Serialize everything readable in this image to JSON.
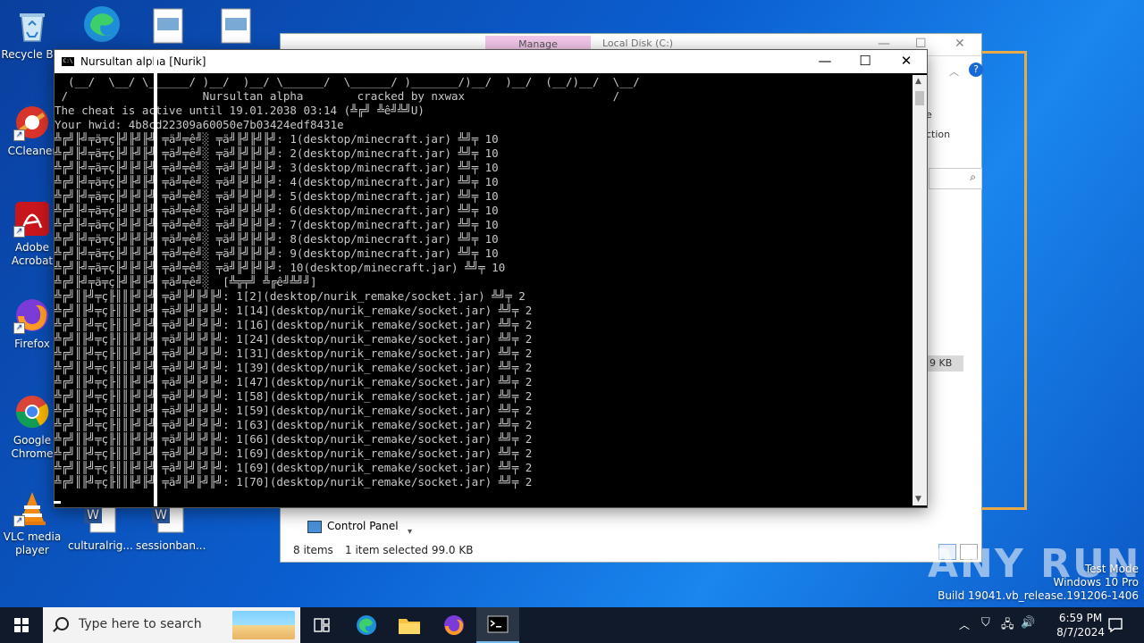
{
  "desktop": {
    "icons": [
      {
        "label": "Recycle Bin",
        "icon": "recycle-bin-icon"
      },
      {
        "label": "CCleaner",
        "icon": "ccleaner-icon"
      },
      {
        "label": "Adobe Acrobat",
        "icon": "adobe-acrobat-icon"
      },
      {
        "label": "Firefox",
        "icon": "firefox-icon"
      },
      {
        "label": "Google Chrome",
        "icon": "chrome-icon"
      },
      {
        "label": "VLC media player",
        "icon": "vlc-icon"
      },
      {
        "label": "culturalrig...",
        "icon": "word-doc-icon"
      },
      {
        "label": "sessionban...",
        "icon": "word-doc-icon"
      }
    ]
  },
  "explorer": {
    "manage_tab": "Manage",
    "title": "Local Disk (C:)",
    "side_fragments": [
      "e",
      "ction"
    ],
    "control_panel": "Control Panel",
    "size_badge": "9 KB",
    "status_items": "8 items",
    "status_selected": "1 item selected  99.0 KB"
  },
  "console": {
    "title": "Nursultan alpha [Nurik]",
    "lines": [
      "  (__/  \\__/ \\______/ )__/  )__/ \\______/  \\______/ )_______/)__/  )__/  (__/)__/  \\__/",
      " /                    Nursultan alpha        cracked by nxwax                      /",
      "The cheat is active until 19.01.2038 03:14 (╩╔╝ ╩ê╝╩╝U)",
      "Your hwid: 4b8cd22309a60050e7b03424edf8431e",
      "╩╔╝╟╝╤ä╤ç╟╝╟╝╟╝ ╤ä╝╤ê╝░ ╤ä╝╟╝╟╝╟╝: 1(desktop/minecraft.jar) ╩╝╤ 10",
      "╩╔╝╟╝╤ä╤ç╟╝╟╝╟╝ ╤ä╝╤ê╝░ ╤ä╝╟╝╟╝╟╝: 2(desktop/minecraft.jar) ╩╝╤ 10",
      "╩╔╝╟╝╤ä╤ç╟╝╟╝╟╝ ╤ä╝╤ê╝░ ╤ä╝╟╝╟╝╟╝: 3(desktop/minecraft.jar) ╩╝╤ 10",
      "╩╔╝╟╝╤ä╤ç╟╝╟╝╟╝ ╤ä╝╤ê╝░ ╤ä╝╟╝╟╝╟╝: 4(desktop/minecraft.jar) ╩╝╤ 10",
      "╩╔╝╟╝╤ä╤ç╟╝╟╝╟╝ ╤ä╝╤ê╝░ ╤ä╝╟╝╟╝╟╝: 5(desktop/minecraft.jar) ╩╝╤ 10",
      "╩╔╝╟╝╤ä╤ç╟╝╟╝╟╝ ╤ä╝╤ê╝░ ╤ä╝╟╝╟╝╟╝: 6(desktop/minecraft.jar) ╩╝╤ 10",
      "╩╔╝╟╝╤ä╤ç╟╝╟╝╟╝ ╤ä╝╤ê╝░ ╤ä╝╟╝╟╝╟╝: 7(desktop/minecraft.jar) ╩╝╤ 10",
      "╩╔╝╟╝╤ä╤ç╟╝╟╝╟╝ ╤ä╝╤ê╝░ ╤ä╝╟╝╟╝╟╝: 8(desktop/minecraft.jar) ╩╝╤ 10",
      "╩╔╝╟╝╤ä╤ç╟╝╟╝╟╝ ╤ä╝╤ê╝░ ╤ä╝╟╝╟╝╟╝: 9(desktop/minecraft.jar) ╩╝╤ 10",
      "╩╔╝╟╝╤ä╤ç╟╝╟╝╟╝ ╤ä╝╤ê╝░ ╤ä╝╟╝╟╝╟╝: 10(desktop/minecraft.jar) ╩╝╤ 10",
      "╩╔╝╟╝╤ä╤ç╟╝╟╝╟╝ ╤ä╝╤ê╝░  [╩╦╤╝ ╩╔ê╝╩╝╝]",
      "╩╔╝║╟╝╤ç╟║║╟╝╟╝ ╤ä╝╟╝╟╝╟╝: 1[2](desktop/nurik_remake/socket.jar) ╩╝╤ 2",
      "╩╔╝║╟╝╤ç╟║║╟╝╟╝ ╤ä╝╟╝╟╝╟╝: 1[14](desktop/nurik_remake/socket.jar) ╩╝╤ 2",
      "╩╔╝║╟╝╤ç╟║║╟╝╟╝ ╤ä╝╟╝╟╝╟╝: 1[16](desktop/nurik_remake/socket.jar) ╩╝╤ 2",
      "╩╔╝║╟╝╤ç╟║║╟╝╟╝ ╤ä╝╟╝╟╝╟╝: 1[24](desktop/nurik_remake/socket.jar) ╩╝╤ 2",
      "╩╔╝║╟╝╤ç╟║║╟╝╟╝ ╤ä╝╟╝╟╝╟╝: 1[31](desktop/nurik_remake/socket.jar) ╩╝╤ 2",
      "╩╔╝║╟╝╤ç╟║║╟╝╟╝ ╤ä╝╟╝╟╝╟╝: 1[39](desktop/nurik_remake/socket.jar) ╩╝╤ 2",
      "╩╔╝║╟╝╤ç╟║║╟╝╟╝ ╤ä╝╟╝╟╝╟╝: 1[47](desktop/nurik_remake/socket.jar) ╩╝╤ 2",
      "╩╔╝║╟╝╤ç╟║║╟╝╟╝ ╤ä╝╟╝╟╝╟╝: 1[58](desktop/nurik_remake/socket.jar) ╩╝╤ 2",
      "╩╔╝║╟╝╤ç╟║║╟╝╟╝ ╤ä╝╟╝╟╝╟╝: 1[59](desktop/nurik_remake/socket.jar) ╩╝╤ 2",
      "╩╔╝║╟╝╤ç╟║║╟╝╟╝ ╤ä╝╟╝╟╝╟╝: 1[63](desktop/nurik_remake/socket.jar) ╩╝╤ 2",
      "╩╔╝║╟╝╤ç╟║║╟╝╟╝ ╤ä╝╟╝╟╝╟╝: 1[66](desktop/nurik_remake/socket.jar) ╩╝╤ 2",
      "╩╔╝║╟╝╤ç╟║║╟╝╟╝ ╤ä╝╟╝╟╝╟╝: 1[69](desktop/nurik_remake/socket.jar) ╩╝╤ 2",
      "╩╔╝║╟╝╤ç╟║║╟╝╟╝ ╤ä╝╟╝╟╝╟╝: 1[69](desktop/nurik_remake/socket.jar) ╩╝╤ 2",
      "╩╔╝║╟╝╤ç╟║║╟╝╟╝ ╤ä╝╟╝╟╝╟╝: 1[70](desktop/nurik_remake/socket.jar) ╩╝╤ 2"
    ]
  },
  "taskbar": {
    "search_placeholder": "Type here to search",
    "time": "6:59 PM",
    "date": "8/7/2024"
  },
  "watermark": {
    "brand": "ANY RUN",
    "line1": "Test Mode",
    "line2": "Windows 10 Pro",
    "line3": "Build 19041.vb_release.191206-1406"
  },
  "colors": {
    "accent": "#76b9ed",
    "highlight_frame": "#e8a948",
    "console_text": "#c8c8c8"
  }
}
